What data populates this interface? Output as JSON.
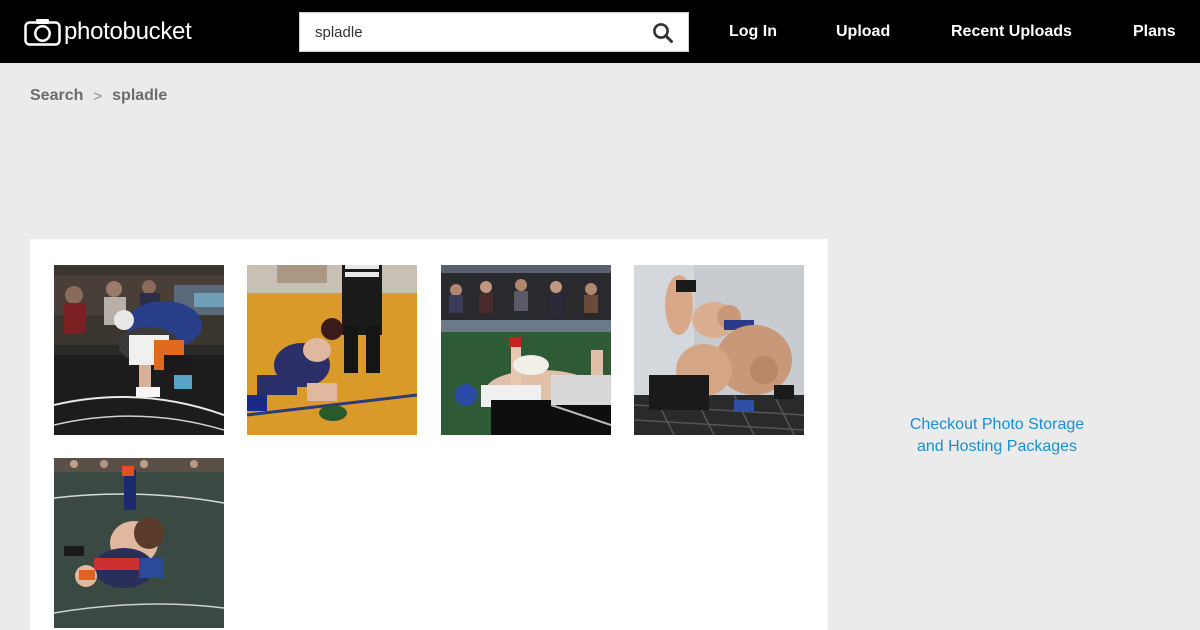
{
  "header": {
    "logo_text": "photobucket",
    "search": {
      "value": "spladle",
      "placeholder": ""
    },
    "nav": {
      "login": "Log In",
      "upload": "Upload",
      "recent": "Recent Uploads",
      "plans": "Plans"
    }
  },
  "breadcrumb": {
    "root": "Search",
    "separator": ">",
    "current": "spladle"
  },
  "results": {
    "count": 5
  },
  "promo": {
    "line1": "Checkout Photo Storage",
    "line2": "and Hosting Packages"
  },
  "colors": {
    "header_bg": "#000000",
    "page_bg": "#ebebeb",
    "link_blue": "#1b8fd1",
    "breadcrumb_gray": "#6b6b6b"
  }
}
